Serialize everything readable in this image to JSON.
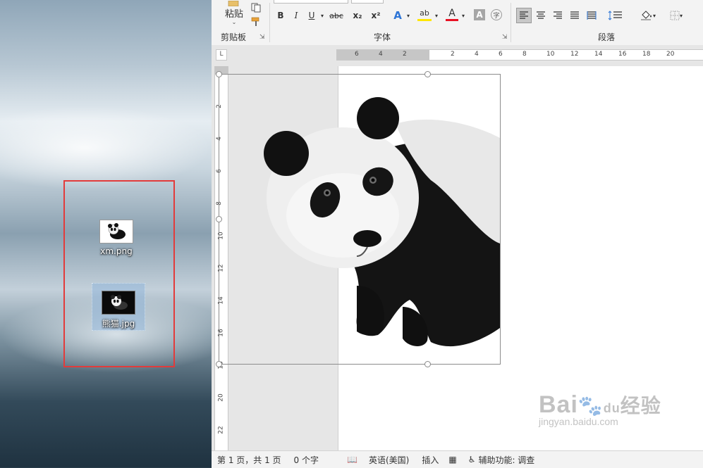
{
  "desktop": {
    "files": [
      {
        "name": "xm.png"
      },
      {
        "name": "熊猫.jpg"
      }
    ]
  },
  "ribbon": {
    "clipboard": {
      "paste_label": "粘贴",
      "group_label": "剪贴板"
    },
    "font": {
      "group_label": "字体",
      "bold": "B",
      "italic": "I",
      "underline": "U",
      "strike": "abc",
      "subscript": "x₂",
      "superscript": "x²",
      "text_effects": "A",
      "highlight": "ab",
      "font_color": "A",
      "char_shading": "A",
      "enclose": "字"
    },
    "paragraph": {
      "group_label": "段落"
    },
    "colors": {
      "font_color_underline": "#e81123",
      "highlight_underline": "#ffe600",
      "text_effects": "#2e75d6"
    }
  },
  "ruler": {
    "h_left": [
      "6",
      "4",
      "2"
    ],
    "h_right": [
      "2",
      "4",
      "6",
      "8",
      "10",
      "12",
      "14",
      "16",
      "18",
      "20"
    ],
    "v": [
      "2",
      "4",
      "6",
      "8",
      "10",
      "12",
      "14",
      "16",
      "18",
      "20",
      "22"
    ],
    "corner": "L"
  },
  "statusbar": {
    "page": "第 1 页，共 1 页",
    "words": "0 个字",
    "language": "英语(美国)",
    "mode": "插入",
    "accessibility": "辅助功能: 调查"
  },
  "watermark": {
    "main": "Bai",
    "paw_text": "du",
    "brand": "经验",
    "url": "jingyan.baidu.com"
  }
}
